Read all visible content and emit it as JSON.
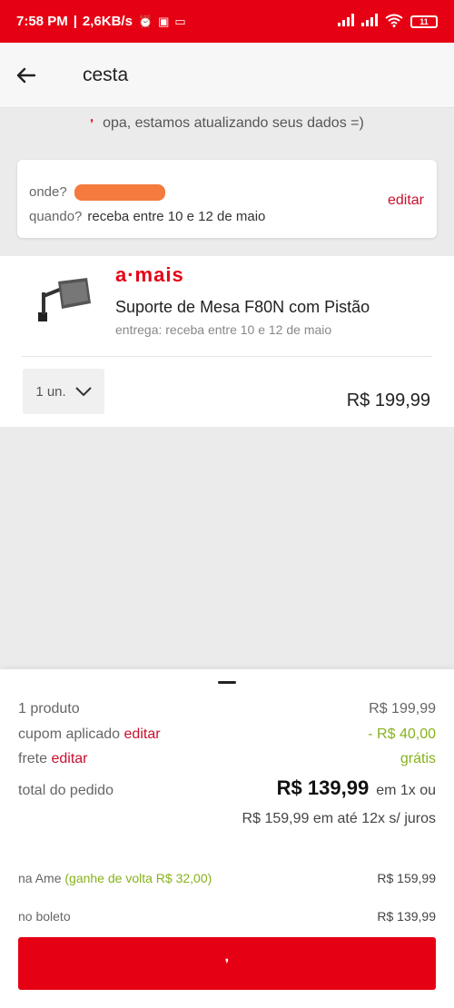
{
  "status": {
    "time": "7:58 PM",
    "network_speed": "2,6KB/s",
    "battery": "11",
    "icons": [
      "alarm-icon",
      "photo-icon",
      "cast-icon",
      "signal-icon",
      "signal-icon",
      "wifi-icon",
      "battery-icon"
    ]
  },
  "header": {
    "title": "cesta",
    "back_icon": "arrow-left-icon"
  },
  "notice": {
    "text": "opa, estamos atualizando seus dados =)"
  },
  "delivery": {
    "where_label": "onde?",
    "when_label": "quando?",
    "when_value": "receba entre 10 e 12 de maio",
    "edit_label": "editar"
  },
  "product": {
    "brand": "a·mais",
    "name": "Suporte de Mesa F80N com Pistão",
    "delivery": "entrega: receba entre 10 e 12 de maio",
    "quantity": "1 un.",
    "price": "R$ 199,99"
  },
  "summary": {
    "products_label": "1 produto",
    "products_value": "R$ 199,99",
    "coupon_label": "cupom aplicado",
    "coupon_edit": "editar",
    "coupon_value": "- R$ 40,00",
    "shipping_label": "frete",
    "shipping_edit": "editar",
    "shipping_value": "grátis",
    "total_label": "total do pedido",
    "total_value": "R$ 139,99",
    "total_suffix": "em 1x ou",
    "installments": "R$ 159,99 em até 12x s/ juros",
    "ame_label": "na Ame",
    "ame_cashback": "(ganhe de volta R$ 32,00)",
    "ame_value": "R$ 159,99",
    "boleto_label": "no boleto",
    "boleto_value": "R$ 139,99"
  },
  "colors": {
    "brand_red": "#e60014",
    "link_red": "#c8102e",
    "green": "#87b21c"
  }
}
